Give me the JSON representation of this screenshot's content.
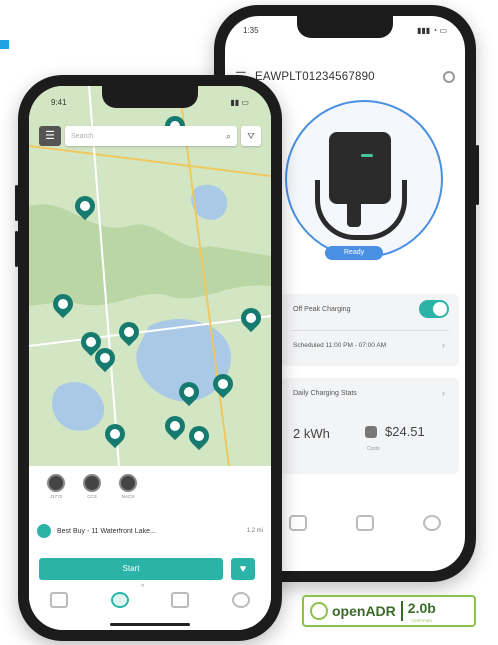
{
  "colors": {
    "accent": "#1fa3e0",
    "teal": "#2bb3a7",
    "pin": "#177a6e",
    "badge_green": "#8bc34a"
  },
  "back_phone": {
    "status_time": "1:35",
    "header": {
      "menu_icon": "hamburger-icon",
      "serial": "EAWPLT01234567890",
      "settings_icon": "gear-icon"
    },
    "charger_status": "Ready",
    "off_peak": {
      "label": "Off Peak Charging",
      "enabled": true,
      "schedule": "Scheduled 11:00 PM - 07:00 AM"
    },
    "daily_stats": {
      "label": "Daily Charging Stats",
      "energy": "2 kWh",
      "cost": "$24.51",
      "cost_sub": "Costs"
    },
    "tabs": [
      "charge-icon",
      "map-icon",
      "stats-icon",
      "settings-icon"
    ]
  },
  "front_phone": {
    "status_time": "9:41",
    "search_placeholder": "Search",
    "connectors": [
      {
        "caption": "J1772"
      },
      {
        "caption": "CCS"
      },
      {
        "caption": "NACS"
      }
    ],
    "station": {
      "name": "Best Buy - 11 Waterfront Lake...",
      "distance": "1.2 mi"
    },
    "start_label": "Start",
    "tabs": [
      "home-icon",
      "map-icon",
      "list-icon",
      "settings-icon"
    ]
  },
  "badge": {
    "brand": "openADR",
    "version": "2.0b",
    "version_sub": "CERTIFIED"
  }
}
